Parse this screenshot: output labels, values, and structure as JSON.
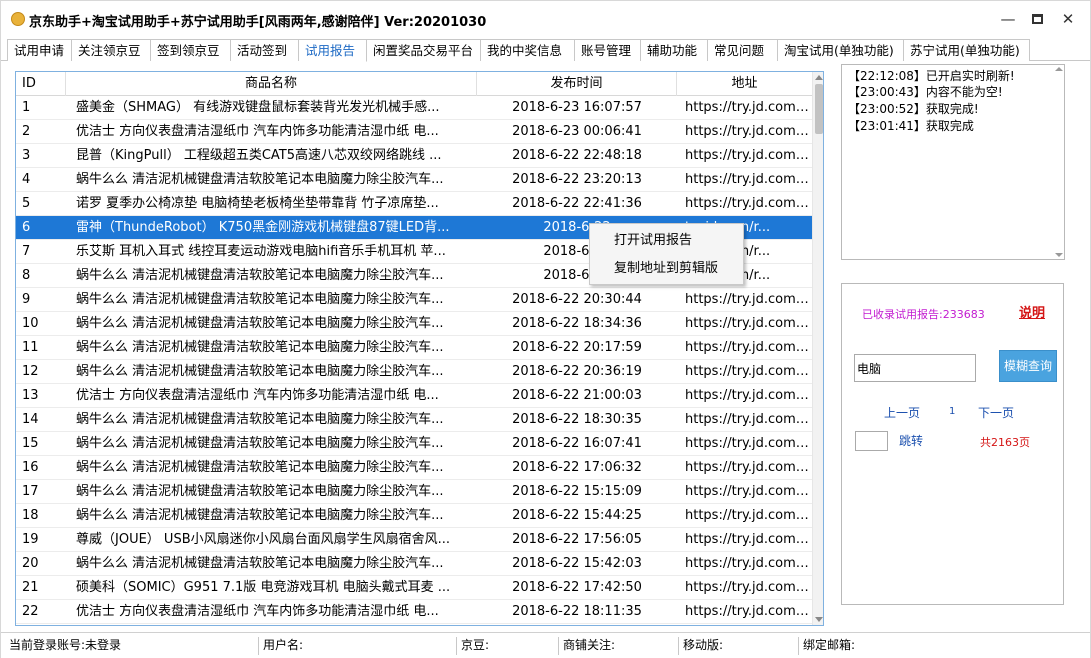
{
  "window": {
    "title": "京东助手+淘宝试用助手+苏宁试用助手[风雨两年,感谢陪伴] Ver:20201030",
    "controls": {
      "minimize": "—",
      "close": "✕"
    }
  },
  "tabs": [
    {
      "label": "试用申请",
      "active": false
    },
    {
      "label": "关注领京豆",
      "active": false
    },
    {
      "label": "签到领京豆",
      "active": false
    },
    {
      "label": "活动签到",
      "active": false
    },
    {
      "label": "试用报告",
      "active": true
    },
    {
      "label": "闲置奖品交易平台",
      "active": false
    },
    {
      "label": "我的中奖信息",
      "active": false
    },
    {
      "label": "账号管理",
      "active": false
    },
    {
      "label": "辅助功能",
      "active": false
    },
    {
      "label": "常见问题",
      "active": false
    },
    {
      "label": "淘宝试用(单独功能)",
      "active": false
    },
    {
      "label": "苏宁试用(单独功能)",
      "active": false
    }
  ],
  "table": {
    "columns": {
      "id": "ID",
      "name": "商品名称",
      "time": "发布时间",
      "addr": "地址"
    },
    "selected_index": 5,
    "rows": [
      {
        "id": "1",
        "name": "盛美金（SHMAG） 有线游戏键盘鼠标套装背光发光机械手感...",
        "time": "2018-6-23 16:07:57",
        "addr": "https://try.jd.com/r..."
      },
      {
        "id": "2",
        "name": " 优洁士 方向仪表盘清洁湿纸巾 汽车内饰多功能清洁湿巾纸 电...",
        "time": "2018-6-23 00:06:41",
        "addr": "https://try.jd.com/r..."
      },
      {
        "id": "3",
        "name": "昆普（KingPull） 工程级超五类CAT5高速八芯双绞网络跳线 ...",
        "time": "2018-6-22 22:48:18",
        "addr": "https://try.jd.com/r..."
      },
      {
        "id": "4",
        "name": "蜗牛么么 清洁泥机械键盘清洁软胶笔记本电脑魔力除尘胶汽车...",
        "time": "2018-6-22 23:20:13",
        "addr": "https://try.jd.com/r..."
      },
      {
        "id": "5",
        "name": " 诺罗 夏季办公椅凉垫 电脑椅垫老板椅坐垫带靠背 竹子凉席垫...",
        "time": "2018-6-22 22:41:36",
        "addr": "https://try.jd.com/r..."
      },
      {
        "id": "6",
        "name": "雷神（ThundeRobot） K750黑金刚游戏机械键盘87键LED背...",
        "time": "2018-6-22 ",
        "addr": "try.jd.com/r..."
      },
      {
        "id": "7",
        "name": "乐艾斯 耳机入耳式 线控耳麦运动游戏电脑hifi音乐手机耳机 苹...",
        "time": "2018-6-22 ",
        "addr": "try.jd.com/r..."
      },
      {
        "id": "8",
        "name": "蜗牛么么 清洁泥机械键盘清洁软胶笔记本电脑魔力除尘胶汽车...",
        "time": "2018-6-22 ",
        "addr": "try.jd.com/r..."
      },
      {
        "id": "9",
        "name": "蜗牛么么 清洁泥机械键盘清洁软胶笔记本电脑魔力除尘胶汽车...",
        "time": "2018-6-22 20:30:44",
        "addr": "https://try.jd.com/r..."
      },
      {
        "id": "10",
        "name": "蜗牛么么 清洁泥机械键盘清洁软胶笔记本电脑魔力除尘胶汽车...",
        "time": "2018-6-22 18:34:36",
        "addr": "https://try.jd.com/r..."
      },
      {
        "id": "11",
        "name": "蜗牛么么 清洁泥机械键盘清洁软胶笔记本电脑魔力除尘胶汽车...",
        "time": "2018-6-22 20:17:59",
        "addr": "https://try.jd.com/r..."
      },
      {
        "id": "12",
        "name": "蜗牛么么 清洁泥机械键盘清洁软胶笔记本电脑魔力除尘胶汽车...",
        "time": "2018-6-22 20:36:19",
        "addr": "https://try.jd.com/r..."
      },
      {
        "id": "13",
        "name": " 优洁士 方向仪表盘清洁湿纸巾 汽车内饰多功能清洁湿巾纸 电...",
        "time": "2018-6-22 21:00:03",
        "addr": "https://try.jd.com/r..."
      },
      {
        "id": "14",
        "name": "蜗牛么么 清洁泥机械键盘清洁软胶笔记本电脑魔力除尘胶汽车...",
        "time": "2018-6-22 18:30:35",
        "addr": "https://try.jd.com/r..."
      },
      {
        "id": "15",
        "name": "蜗牛么么 清洁泥机械键盘清洁软胶笔记本电脑魔力除尘胶汽车...",
        "time": "2018-6-22 16:07:41",
        "addr": "https://try.jd.com/r..."
      },
      {
        "id": "16",
        "name": "蜗牛么么 清洁泥机械键盘清洁软胶笔记本电脑魔力除尘胶汽车...",
        "time": "2018-6-22 17:06:32",
        "addr": "https://try.jd.com/r..."
      },
      {
        "id": "17",
        "name": "蜗牛么么 清洁泥机械键盘清洁软胶笔记本电脑魔力除尘胶汽车...",
        "time": "2018-6-22 15:15:09",
        "addr": "https://try.jd.com/r..."
      },
      {
        "id": "18",
        "name": "蜗牛么么 清洁泥机械键盘清洁软胶笔记本电脑魔力除尘胶汽车...",
        "time": "2018-6-22 15:44:25",
        "addr": "https://try.jd.com/r..."
      },
      {
        "id": "19",
        "name": "尊威（JOUE） USB小风扇迷你小风扇台面风扇学生风扇宿舍风...",
        "time": "2018-6-22 17:56:05",
        "addr": "https://try.jd.com/r..."
      },
      {
        "id": "20",
        "name": "蜗牛么么 清洁泥机械键盘清洁软胶笔记本电脑魔力除尘胶汽车...",
        "time": "2018-6-22 15:42:03",
        "addr": "https://try.jd.com/r..."
      },
      {
        "id": "21",
        "name": "硕美科（SOMIC）G951 7.1版 电竞游戏耳机 电脑头戴式耳麦 ...",
        "time": "2018-6-22 17:42:50",
        "addr": "https://try.jd.com/r..."
      },
      {
        "id": "22",
        "name": " 优洁士 方向仪表盘清洁湿纸巾 汽车内饰多功能清洁湿巾纸 电...",
        "time": "2018-6-22 18:11:35",
        "addr": "https://try.jd.com/r..."
      }
    ]
  },
  "context_menu": {
    "items": [
      "打开试用报告",
      "复制地址到剪辑版"
    ]
  },
  "log": {
    "lines": [
      "【22:12:08】已开启实时刷新!",
      "【23:00:43】内容不能为空!",
      "【23:00:52】获取完成!",
      "【23:01:41】获取完成"
    ]
  },
  "panel": {
    "collected_label": "已收录试用报告:233683",
    "explain_label": "说明",
    "search_value": "电脑",
    "fuzzy_button": "模糊查询",
    "prev_page": "上一页",
    "current_page": "1",
    "next_page": "下一页",
    "jump_value": "",
    "jump_button": "跳转",
    "total_pages": "共2163页"
  },
  "statusbar": {
    "login": "当前登录账号:未登录",
    "username": "用户名:",
    "jingdou": "京豆:",
    "shop_follow": "商铺关注:",
    "mobile": "移动版:",
    "email": "绑定邮箱:"
  },
  "colors": {
    "accent_tab": "#1c69c4",
    "selection": "#1e78d6",
    "collected_text": "#c21bd0",
    "warning_red": "#d41414",
    "button_blue": "#4aa3df"
  }
}
